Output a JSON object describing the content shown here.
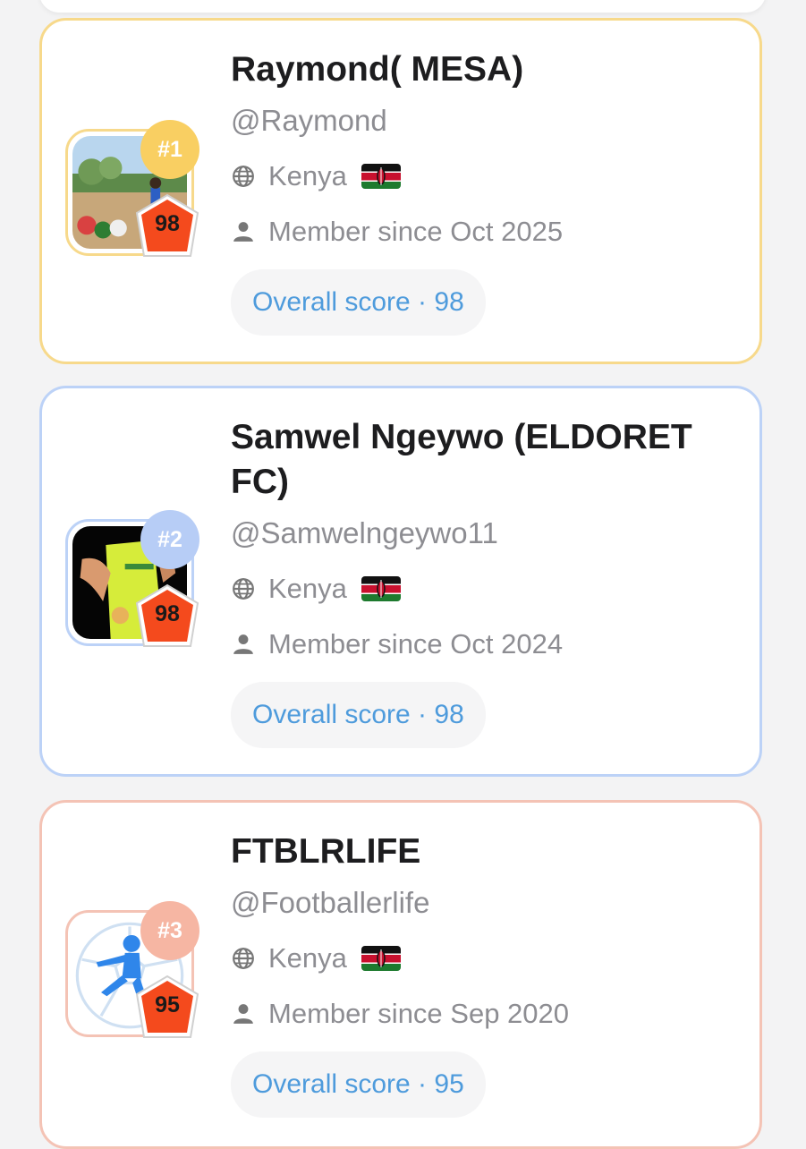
{
  "players": [
    {
      "rank": "#1",
      "name": "Raymond( MESA)",
      "handle": "@Raymond",
      "country": "Kenya",
      "member_since": "Member since Oct 2025",
      "score": "98",
      "overall_label": "Overall score · 98",
      "accent": "#f9cf62"
    },
    {
      "rank": "#2",
      "name": "Samwel Ngeywo (ELDORET FC)",
      "handle": "@Samwelngeywo11",
      "country": "Kenya",
      "member_since": "Member since Oct 2024",
      "score": "98",
      "overall_label": "Overall score · 98",
      "accent": "#b7cdf6"
    },
    {
      "rank": "#3",
      "name": "FTBLRLIFE",
      "handle": "@Footballerlife",
      "country": "Kenya",
      "member_since": "Member since Sep 2020",
      "score": "95",
      "overall_label": "Overall score · 95",
      "accent": "#f6b6a3"
    }
  ],
  "icons": {
    "country": "globe-icon",
    "member": "person-icon",
    "flag": "kenya-flag-icon",
    "score": "score-shield-icon"
  },
  "colors": {
    "score_text": "#4e9bdc",
    "score_badge": "#f44a1d"
  }
}
